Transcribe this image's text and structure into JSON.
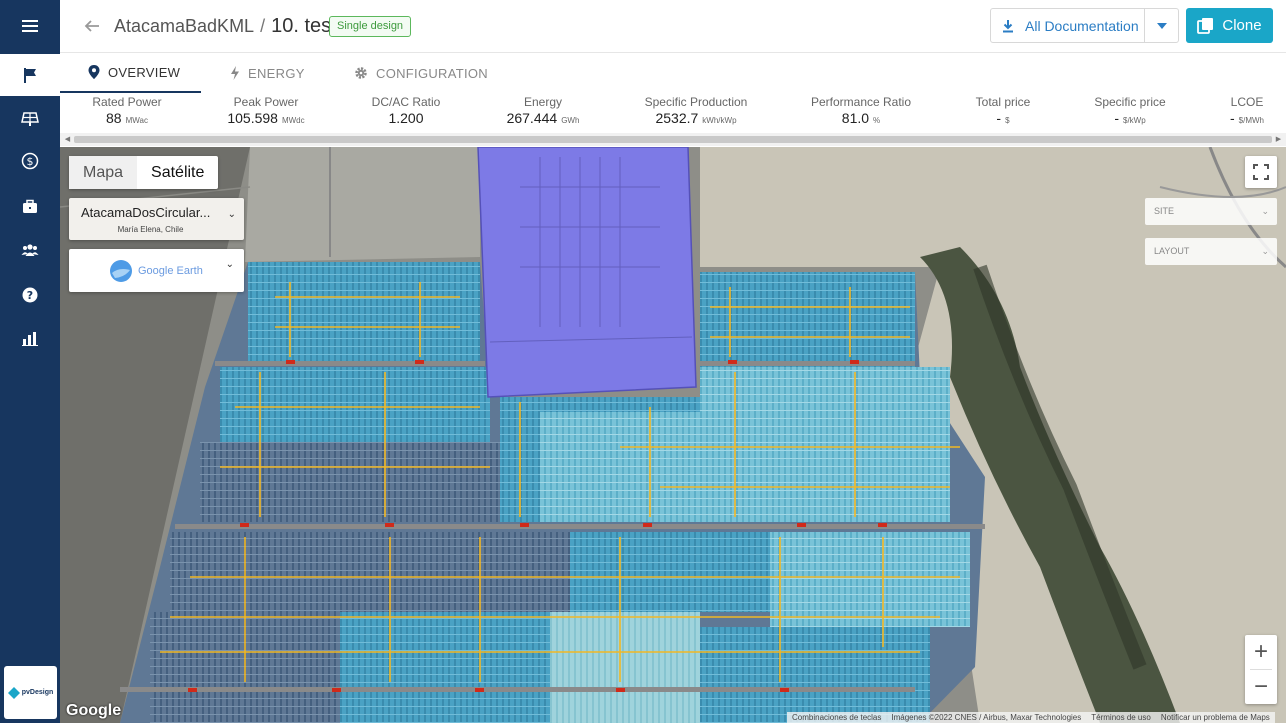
{
  "sidebar": {
    "items": [
      {
        "icon": "menu-icon"
      },
      {
        "icon": "flag-icon",
        "active": true
      },
      {
        "icon": "solar-panel-icon"
      },
      {
        "icon": "dollar-icon"
      },
      {
        "icon": "briefcase-icon"
      },
      {
        "icon": "users-icon"
      },
      {
        "icon": "help-icon"
      },
      {
        "icon": "bar-chart-icon"
      }
    ],
    "logo_text": "pvDesign"
  },
  "header": {
    "project": "AtacamaBadKML",
    "separator": "/",
    "design": "10. test",
    "badge": "Single design",
    "doc_button": "All Documentation",
    "clone_button": "Clone"
  },
  "tabs": [
    {
      "label": "OVERVIEW",
      "icon": "location-pin-icon",
      "active": true
    },
    {
      "label": "ENERGY",
      "icon": "bolt-icon"
    },
    {
      "label": "CONFIGURATION",
      "icon": "gear-icon"
    }
  ],
  "kpis": [
    {
      "label": "Rated Power",
      "value": "88",
      "unit": "MWac"
    },
    {
      "label": "Peak Power",
      "value": "105.598",
      "unit": "MWdc"
    },
    {
      "label": "DC/AC Ratio",
      "value": "1.200",
      "unit": ""
    },
    {
      "label": "Energy",
      "value": "267.444",
      "unit": "GWh"
    },
    {
      "label": "Specific Production",
      "value": "2532.7",
      "unit": "kWh/kWp"
    },
    {
      "label": "Performance Ratio",
      "value": "81.0",
      "unit": "%"
    },
    {
      "label": "Total price",
      "value": "-",
      "unit": "$"
    },
    {
      "label": "Specific price",
      "value": "-",
      "unit": "$/kWp"
    },
    {
      "label": "LCOE",
      "value": "-",
      "unit": "$/MWh"
    }
  ],
  "map": {
    "type_map": "Mapa",
    "type_satellite": "Satélite",
    "location_name": "AtacamaDosCircular...",
    "location_sub": "María Elena, Chile",
    "google_earth": "Google Earth",
    "site_placeholder": "SITE",
    "layout_placeholder": "LAYOUT",
    "zoom_in": "+",
    "zoom_out": "−",
    "google_logo": "Google",
    "attribution": [
      "Combinaciones de teclas",
      "Imágenes ©2022 CNES / Airbus, Maxar Technologies",
      "Términos de uso",
      "Notificar un problema de Maps"
    ]
  }
}
